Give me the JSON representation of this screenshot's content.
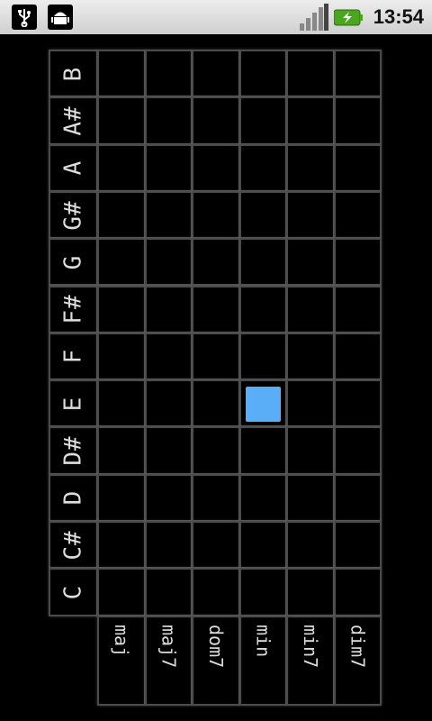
{
  "status_bar": {
    "time": "13:54",
    "icons": [
      "usb-icon",
      "android-debug-icon",
      "signal-icon",
      "battery-charging-icon"
    ]
  },
  "notes": [
    "B",
    "A#",
    "A",
    "G#",
    "G",
    "F#",
    "F",
    "E",
    "D#",
    "D",
    "C#",
    "C"
  ],
  "chords": [
    "maj",
    "maj7",
    "dom7",
    "min",
    "min7",
    "dim7"
  ],
  "selection": {
    "note": "E",
    "chord": "min",
    "color": "#5aaef7"
  }
}
